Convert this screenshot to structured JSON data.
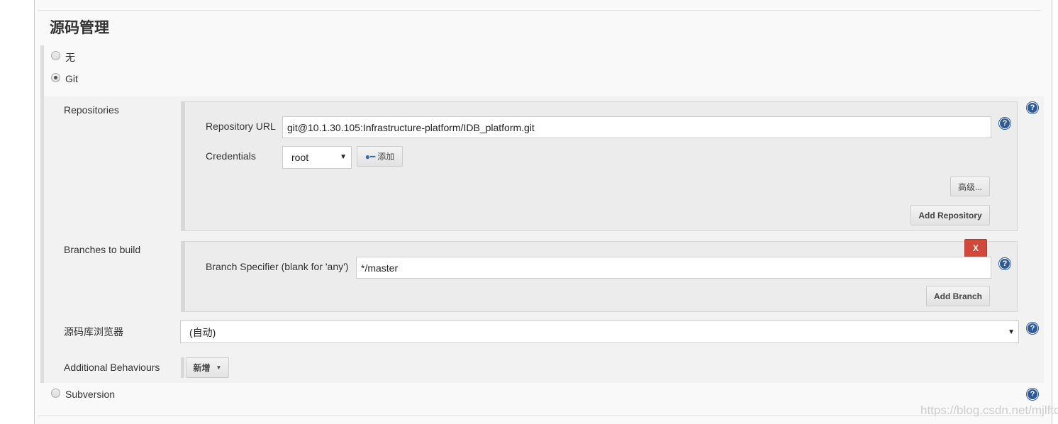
{
  "section_title": "源码管理",
  "scm_options": [
    {
      "label": "无",
      "selected": false
    },
    {
      "label": "Git",
      "selected": true
    },
    {
      "label": "Subversion",
      "selected": false
    }
  ],
  "git": {
    "repositories_label": "Repositories",
    "repo_url_label": "Repository URL",
    "repo_url_value": "git@10.1.30.105:Infrastructure-platform/IDB_platform.git",
    "credentials_label": "Credentials",
    "credentials_value": "root",
    "add_credentials_label": "添加",
    "advanced_label": "高级...",
    "add_repository_label": "Add Repository",
    "branches_label": "Branches to build",
    "branch_specifier_label": "Branch Specifier (blank for 'any')",
    "branch_specifier_value": "*/master",
    "delete_branch_label": "X",
    "add_branch_label": "Add Branch",
    "browser_label": "源码库浏览器",
    "browser_value": "(自动)",
    "behaviours_label": "Additional Behaviours",
    "add_behaviour_label": "新增"
  },
  "help_glyph": "?",
  "watermark": "https://blog.csdn.net/mjlfto",
  "colors": {
    "delete": "#d24939",
    "help": "#2d5a9b"
  }
}
